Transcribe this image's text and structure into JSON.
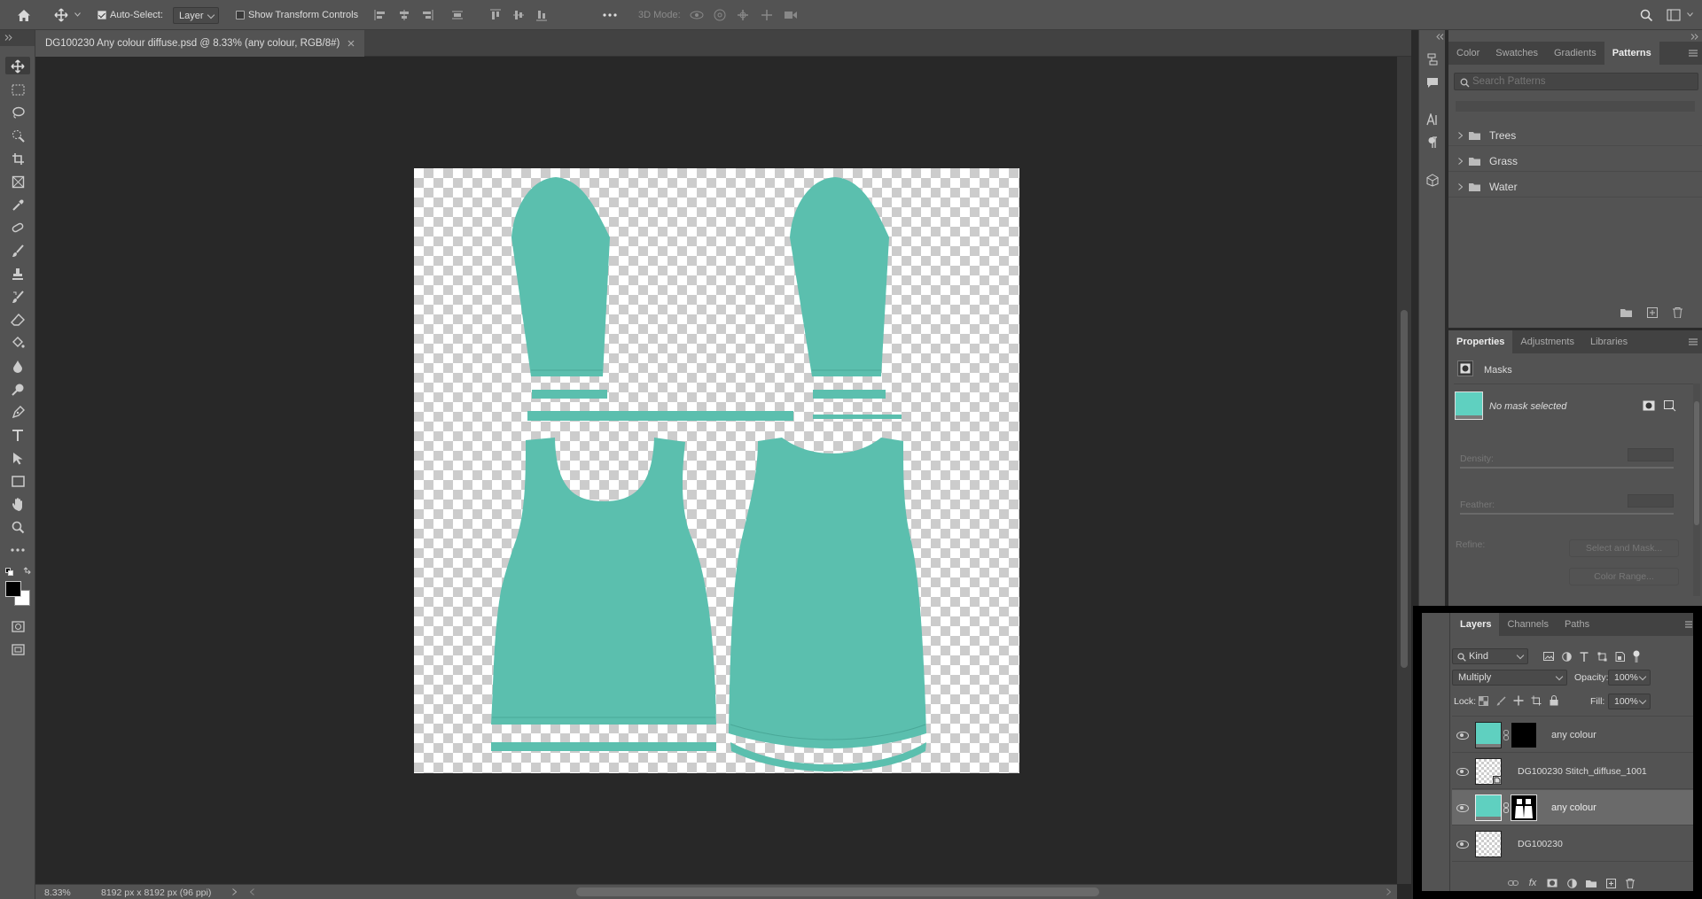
{
  "options_bar": {
    "auto_select_label": "Auto-Select:",
    "auto_select_target": "Layer",
    "show_transform_label": "Show Transform Controls",
    "mode_3d_label": "3D Mode:",
    "more_icon": "more-horizontal-icon"
  },
  "document": {
    "tab_title": "DG100230 Any colour diffuse.psd @ 8.33% (any colour, RGB/8#)",
    "zoom": "8.33%",
    "dimensions": "8192 px x 8192 px (96 ppi)"
  },
  "colors": {
    "garment": "#5bbfae",
    "foreground": "#000000",
    "background": "#ffffff",
    "accent_tab": "#535353"
  },
  "patterns_panel": {
    "tabs": [
      "Color",
      "Swatches",
      "Gradients",
      "Patterns"
    ],
    "active_tab": "Patterns",
    "search_placeholder": "Search Patterns",
    "groups": [
      {
        "label": "Trees"
      },
      {
        "label": "Grass"
      },
      {
        "label": "Water"
      }
    ]
  },
  "properties_panel": {
    "tabs": [
      "Properties",
      "Adjustments",
      "Libraries"
    ],
    "active_tab": "Properties",
    "section": "Masks",
    "mask_status": "No mask selected",
    "density_label": "Density:",
    "feather_label": "Feather:",
    "refine_label": "Refine:",
    "select_and_mask": "Select and Mask...",
    "color_range": "Color Range..."
  },
  "layers_panel": {
    "tabs": [
      "Layers",
      "Channels",
      "Paths"
    ],
    "active_tab": "Layers",
    "filter_kind": "Kind",
    "blend_mode": "Multiply",
    "opacity_label": "Opacity:",
    "opacity_value": "100%",
    "lock_label": "Lock:",
    "fill_label": "Fill:",
    "fill_value": "100%",
    "layers": [
      {
        "name": "any colour",
        "selected": false
      },
      {
        "name": "DG100230 Stitch_diffuse_1001",
        "selected": false
      },
      {
        "name": "any colour",
        "selected": true
      },
      {
        "name": "DG100230",
        "selected": false
      }
    ]
  }
}
